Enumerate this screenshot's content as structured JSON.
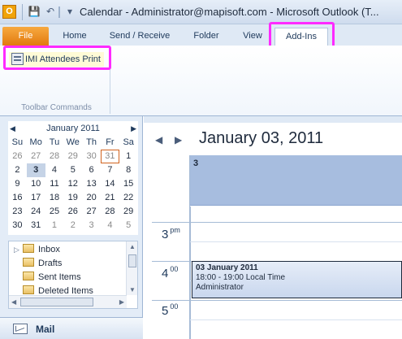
{
  "window": {
    "title": "Calendar - Administrator@mapisoft.com  -  Microsoft Outlook (T..."
  },
  "quick_access": {
    "app_icon": "outlook-icon",
    "items": [
      "save-icon",
      "undo-icon",
      "customize-dropdown-icon"
    ]
  },
  "ribbon": {
    "tabs": [
      {
        "label": "File"
      },
      {
        "label": "Home"
      },
      {
        "label": "Send / Receive"
      },
      {
        "label": "Folder"
      },
      {
        "label": "View"
      },
      {
        "label": "Add-Ins"
      }
    ],
    "active_tab": "Add-Ins",
    "button_label": "IMI Attendees Print",
    "group_label": "Toolbar Commands",
    "highlight_color": "#ff2aff"
  },
  "mini_calendar": {
    "month_label": "January 2011",
    "days_of_week": [
      "Su",
      "Mo",
      "Tu",
      "We",
      "Th",
      "Fr",
      "Sa"
    ],
    "weeks": [
      [
        "26",
        "27",
        "28",
        "29",
        "30",
        "31",
        "1"
      ],
      [
        "2",
        "3",
        "4",
        "5",
        "6",
        "7",
        "8"
      ],
      [
        "9",
        "10",
        "11",
        "12",
        "13",
        "14",
        "15"
      ],
      [
        "16",
        "17",
        "18",
        "19",
        "20",
        "21",
        "22"
      ],
      [
        "23",
        "24",
        "25",
        "26",
        "27",
        "28",
        "29"
      ],
      [
        "30",
        "31",
        "1",
        "2",
        "3",
        "4",
        "5"
      ]
    ],
    "selected_day": "3",
    "today_day": "31"
  },
  "folders": [
    {
      "label": "Inbox",
      "expandable": true
    },
    {
      "label": "Drafts",
      "expandable": false
    },
    {
      "label": "Sent Items",
      "expandable": false
    },
    {
      "label": "Deleted Items",
      "expandable": false
    }
  ],
  "nav_bar": {
    "mail_label": "Mail"
  },
  "day_view": {
    "title": "January 03, 2011",
    "day_header_number": "3",
    "times": [
      {
        "hour": "3",
        "suffix": "pm"
      },
      {
        "hour": "4",
        "suffix": "00"
      },
      {
        "hour": "5",
        "suffix": "00"
      }
    ],
    "appointment": {
      "title": "03 January 2011",
      "time": "18:00 - 19:00 Local Time",
      "organizer": "Administrator"
    },
    "colors": {
      "day_header": "#a7bddf",
      "appointment_border": "#1e2a3c"
    }
  }
}
